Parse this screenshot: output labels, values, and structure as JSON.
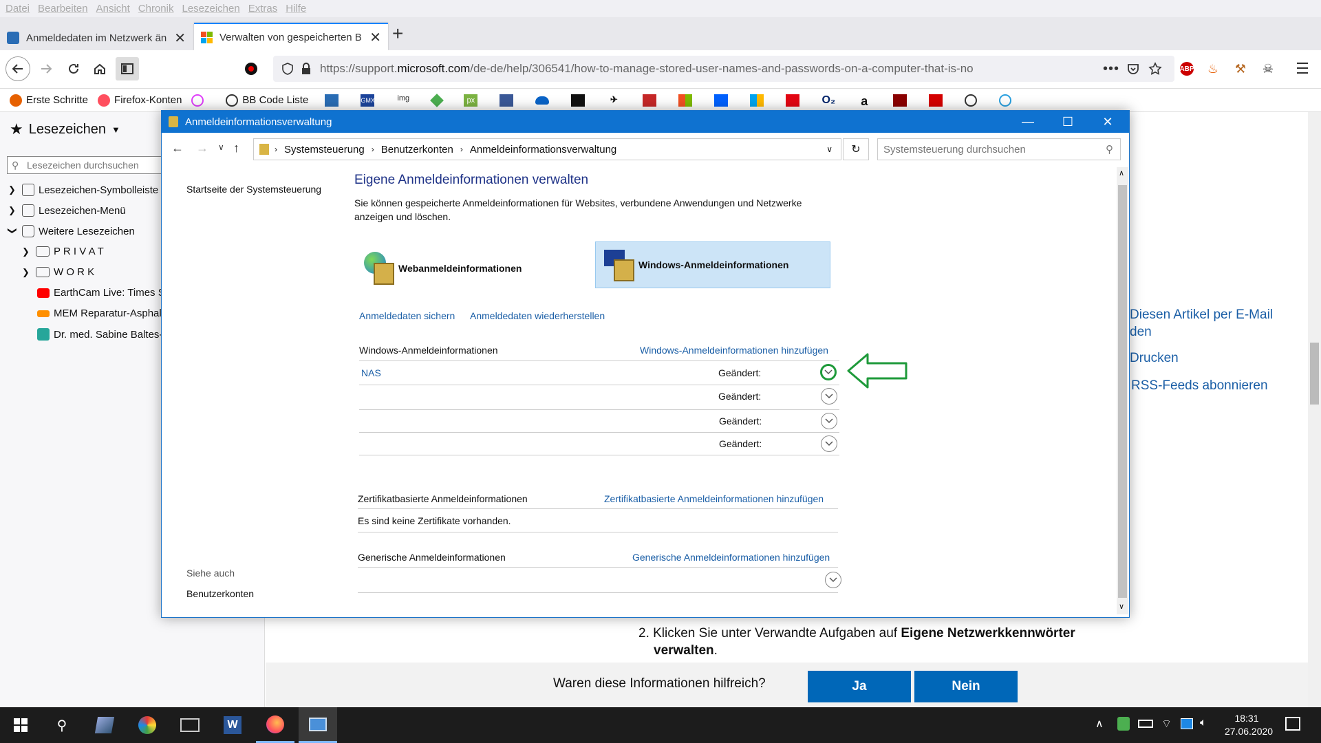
{
  "menu": [
    "Datei",
    "Bearbeiten",
    "Ansicht",
    "Chronik",
    "Lesezeichen",
    "Extras",
    "Hilfe"
  ],
  "tabs": [
    {
      "title": "Anmeldedaten im Netzwerk än"
    },
    {
      "title": "Verwalten von gespeicherten B"
    }
  ],
  "url": {
    "prefix": "https://support.",
    "domain": "microsoft.com",
    "path": "/de-de/help/306541/how-to-manage-stored-user-names-and-passwords-on-a-computer-that-is-no"
  },
  "bookmarks_bar": [
    "Erste Schritte",
    "Firefox-Konten",
    "BB Code Liste"
  ],
  "bookmark_icon_texts": [
    "GMX",
    "img",
    "px",
    "O₂",
    "a"
  ],
  "sidebar": {
    "title": "Lesezeichen",
    "search_placeholder": "Lesezeichen durchsuchen",
    "items": [
      "Lesezeichen-Symbolleiste",
      "Lesezeichen-Menü",
      "Weitere Lesezeichen",
      "P R I V A T",
      "W O R K",
      "EarthCam Live: Times Sq",
      "MEM Reparatur-Asphalt",
      "Dr. med. Sabine Baltes-"
    ]
  },
  "page": {
    "links": [
      "Diesen Artikel per E-Mail",
      "den",
      "Drucken",
      "RSS-Feeds abonnieren"
    ],
    "step_prefix": "2. Klicken Sie unter Verwandte Aufgaben auf ",
    "step_bold": "Eigene Netzwerkkennwörter",
    "step_bold2": "verwalten",
    "step_end": ".",
    "feedback_question": "Waren diese Informationen hilfreich?",
    "yes": "Ja",
    "no": "Nein"
  },
  "dialog": {
    "title": "Anmeldeinformationsverwaltung",
    "breadcrumb": [
      "Systemsteuerung",
      "Benutzerkonten",
      "Anmeldeinformationsverwaltung"
    ],
    "search_placeholder": "Systemsteuerung durchsuchen",
    "left_link": "Startseite der Systemsteuerung",
    "see_also": "Siehe auch",
    "see_also_link": "Benutzerkonten",
    "heading": "Eigene Anmeldeinformationen verwalten",
    "description1": "Sie können gespeicherte Anmeldeinformationen für Websites, verbundene Anwendungen und Netzwerke",
    "description2": "anzeigen und löschen.",
    "web_creds": "Webanmeldeinformationen",
    "win_creds": "Windows-Anmeldeinformationen",
    "backup": "Anmeldedaten sichern",
    "restore": "Anmeldedaten wiederherstellen",
    "win_section": "Windows-Anmeldeinformationen",
    "win_add": "Windows-Anmeldeinformationen hinzufügen",
    "rows": [
      {
        "name": "NAS",
        "changed": "Geändert:"
      },
      {
        "name": "",
        "changed": "Geändert:"
      },
      {
        "name": "",
        "changed": "Geändert:"
      },
      {
        "name": "",
        "changed": "Geändert:"
      }
    ],
    "cert_section": "Zertifikatbasierte Anmeldeinformationen",
    "cert_add": "Zertifikatbasierte Anmeldeinformationen hinzufügen",
    "cert_empty": "Es sind keine Zertifikate vorhanden.",
    "gen_section": "Generische Anmeldeinformationen",
    "gen_add": "Generische Anmeldeinformationen hinzufügen"
  },
  "taskbar": {
    "time": "18:31",
    "date": "27.06.2020"
  },
  "colors": {
    "accent": "#0f72d0",
    "link": "#1a5ea6",
    "highlight_arrow": "#1e9a3a",
    "button": "#0067b8"
  }
}
